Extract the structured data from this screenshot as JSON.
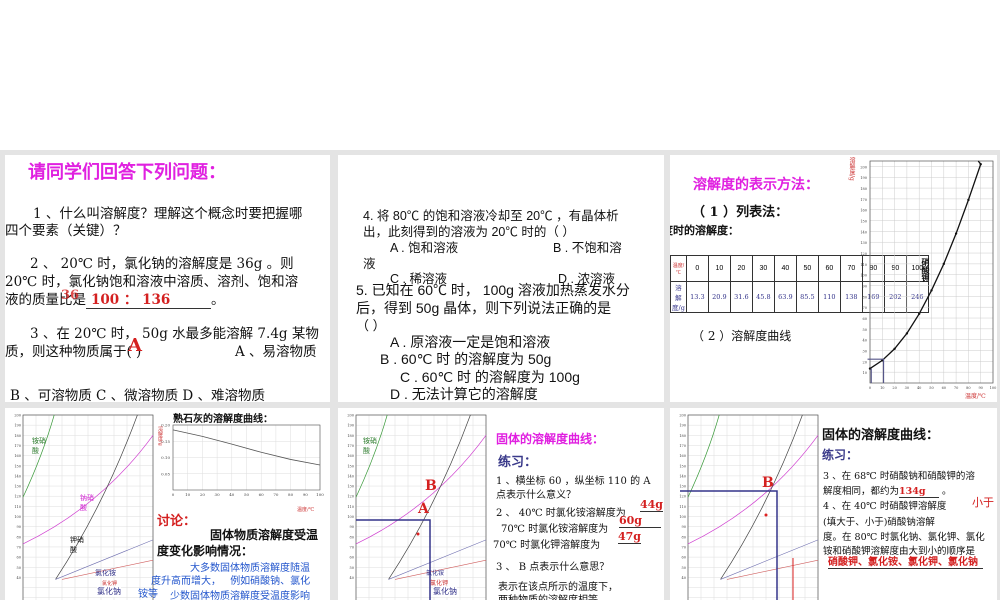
{
  "slide1": {
    "title": "请同学们回答下列问题：",
    "q1": "1 、什么叫溶解度？理解这个概念时要把握哪",
    "q1b": "四个要素（关键）？",
    "q2": "2 、 20℃ 时，氯化钠的溶解度是 36g 。则",
    "q2b": "20℃ 时，氯化钠饱和溶液中溶质、溶剂、饱和溶",
    "q2c": "液的质量比是",
    "q2_ans_over": "36",
    "q2_ans": "100 ： 136",
    "q2_end": "。",
    "q3": "3 、在 20℃ 时， 50g 水最多能溶解 7.4g 某物",
    "q3b": "质，则这种物质属于(        )",
    "q3_ans": "A",
    "q3_optA": "A 、易溶物质",
    "q3_opts": "B 、可溶物质      C 、微溶物质      D 、难溶物质"
  },
  "slide2": {
    "q4": "4. 将 80℃ 的饱和溶液冷却至 20℃ ，有晶体析",
    "q4b": "出，此刻得到的溶液为 20℃ 时的（          ）",
    "q4A": "A . 饱和溶液",
    "q4B": "B . 不饱和溶",
    "q4Bb": "液",
    "q4C": "C . 稀溶液",
    "q4D": "D . 浓溶液",
    "q5": "5. 已知在 60℃ 时， 100g 溶液加热蒸发水分",
    "q5b": "后，得到    50g 晶体，则下列说法正确的是",
    "q5c": "（          ）",
    "q5A": "A . 原溶液一定是饱和溶液",
    "q5B": "B .  60℃ 时   的溶解度为 50g",
    "q5C": "C .  60℃ 时   的溶解度为 100g",
    "q5D": "D . 无法计算它的溶解度"
  },
  "slide3": {
    "title": "溶解度的表示方法：",
    "m1": "（ 1 ）列表法：",
    "m1sub": "硝酸钾在不同温度时的溶解度：",
    "m2": "（ 2 ）溶解度曲线",
    "table": {
      "row1_label": "温度/℃",
      "row2_label": "溶解度/g",
      "temps": [
        "0",
        "10",
        "20",
        "30",
        "40",
        "50",
        "60",
        "70",
        "80",
        "90",
        "100"
      ],
      "values": [
        "13.3",
        "20.9",
        "31.6",
        "45.8",
        "63.9",
        "85.5",
        "110",
        "138",
        "169",
        "202",
        "246"
      ]
    },
    "chart": {
      "ylabel": "溶解度/g",
      "xlabel": "温度/℃",
      "curve_label": "硝酸钾",
      "yticks": [
        "10",
        "20",
        "30",
        "40",
        "50",
        "60",
        "70",
        "80",
        "90",
        "100",
        "110",
        "120",
        "130",
        "140",
        "150",
        "160",
        "170",
        "180",
        "190",
        "200"
      ],
      "xticks": [
        "0",
        "10",
        "20",
        "30",
        "40",
        "50",
        "60",
        "70",
        "80",
        "90",
        "100"
      ]
    }
  },
  "slide4": {
    "chart_labels": {
      "ammonium_nitrate": "铵硝酸",
      "sodium_nitrate": "钠硝酸",
      "potassium_nitrate": "钾硝酸",
      "ammonium_chloride": "氯化铵",
      "potassium_chloride": "氯化钾",
      "sodium_chloride": "氯化钠"
    },
    "lime_title": "熟石灰的溶解度曲线：",
    "lime_ylabel": "溶解度/g",
    "lime_xlabel": "温度/℃",
    "lime_yticks": [
      "0.20",
      "0.15",
      "0.10",
      "0.05"
    ],
    "lime_xticks": [
      "0",
      "10",
      "20",
      "30",
      "40",
      "50",
      "60",
      "70",
      "80",
      "90",
      "100"
    ],
    "discuss": "讨论：",
    "d1": "固体物质溶解度受温",
    "d1b": "度变化影响情况：",
    "d2": "大多数固体物质溶解度随温",
    "d2b": "度升高而增大，",
    "d2c": "例如硝酸钠、氯化",
    "d2d": "铵等",
    "d3": "少数固体物质溶解度受温度影响"
  },
  "slide5": {
    "title": "固体的溶解度曲线：",
    "sub": "练习：",
    "e1": "1 、横坐标 60 ，纵坐标 110  的 A",
    "e1b": "点表示什么意义？",
    "e2": "2 、 40℃ 时氯化铵溶解度为",
    "e2_ans": "44g",
    "e2b": "70℃ 时氯化铵溶解度为",
    "e2b_ans": "60g",
    "e2c": "70℃ 时氯化钾溶解度为",
    "e2c_ans": "47g",
    "e3": "3 、 B 点表示什么意思？",
    "e3a": "表示在该点所示的温度下，",
    "e3b": "两种物质的溶解度相等。",
    "pointA": "A",
    "pointB": "B"
  },
  "slide6": {
    "title": "固体的溶解度曲线：",
    "sub": "练习：",
    "e3": "3 、在 68℃ 时硝酸钠和硝酸钾的溶",
    "e3b": "解度相同，都约为",
    "e3b_ans": "134g",
    "e4": "4 、在 40℃ 时硝酸钾溶解度",
    "e4_ans": "小于",
    "e4b": "(填大于、小于)硝酸钠溶解",
    "e4c": "度。在 80℃ 时氯化钠、氯化钾、氯化",
    "e4d": "铵和硝酸钾溶解度由大到小的顺序是",
    "e4_ans2": "硝酸钾、氯化铵、氯化钾、氯化钠",
    "pointB": "B"
  }
}
